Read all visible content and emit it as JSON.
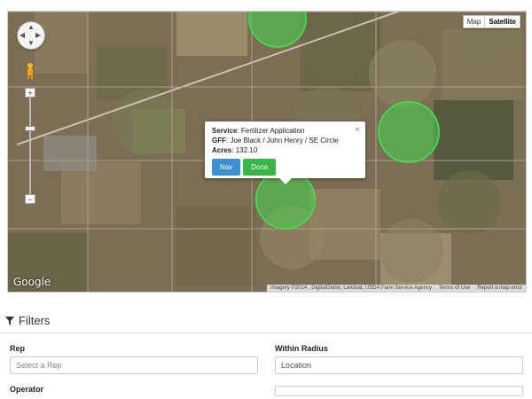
{
  "map": {
    "type_buttons": [
      "Map",
      "Satellite"
    ],
    "active_type": "Satellite",
    "logo": "Google",
    "attribution": {
      "imagery": "Imagery ©2014 , DigitalGlobe, Landsat, USDA Farm Service Agency",
      "terms": "Terms of Use",
      "report": "Report a map error"
    },
    "controls": {
      "zoom_in": "+",
      "zoom_out": "−"
    }
  },
  "popup": {
    "service_label": "Service",
    "service_value": ": Fertilizer Application",
    "gff_label": "GFF",
    "gff_value": ": Joe Black / John Henry / SE Circle",
    "acres_label": "Acres",
    "acres_value": ": 132.10",
    "nav_label": "Nav",
    "done_label": "Done",
    "close_icon": "×"
  },
  "filters": {
    "title": "Filters",
    "rep_label": "Rep",
    "rep_placeholder": "Select a Rep",
    "radius_label": "Within Radius",
    "radius_value": "Location",
    "operator_label": "Operator"
  },
  "colors": {
    "nav": "#3b8fd4",
    "done": "#39b54a",
    "field_highlight": "#47d44f"
  }
}
